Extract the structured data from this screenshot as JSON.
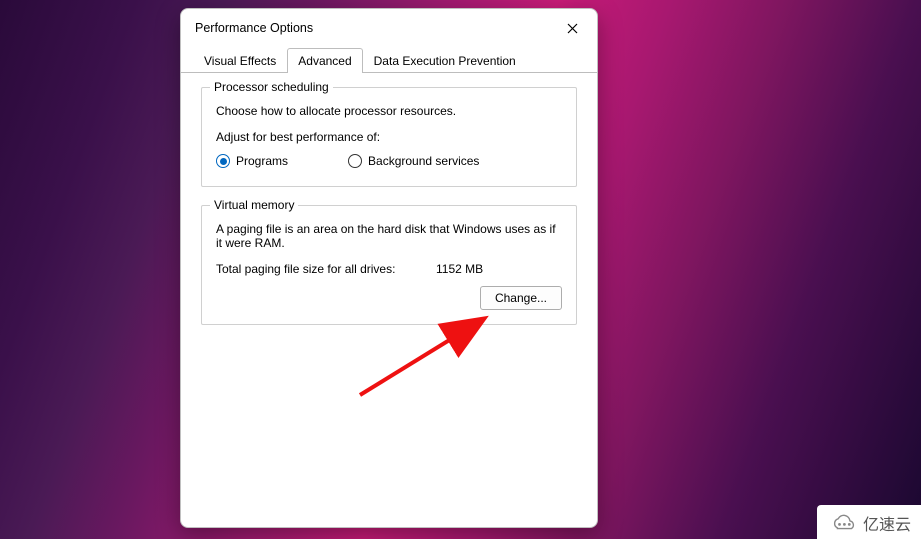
{
  "dialog": {
    "title": "Performance Options",
    "tabs": [
      {
        "label": "Visual Effects"
      },
      {
        "label": "Advanced"
      },
      {
        "label": "Data Execution Prevention"
      }
    ],
    "active_tab_index": 1
  },
  "processor": {
    "legend": "Processor scheduling",
    "desc": "Choose how to allocate processor resources.",
    "adjust_label": "Adjust for best performance of:",
    "radio_programs": "Programs",
    "radio_background": "Background services",
    "selected": "programs"
  },
  "vm": {
    "legend": "Virtual memory",
    "desc": "A paging file is an area on the hard disk that Windows uses as if it were RAM.",
    "total_label": "Total paging file size for all drives:",
    "total_value": "1152 MB",
    "change_button": "Change..."
  },
  "watermark": {
    "text": "亿速云"
  }
}
